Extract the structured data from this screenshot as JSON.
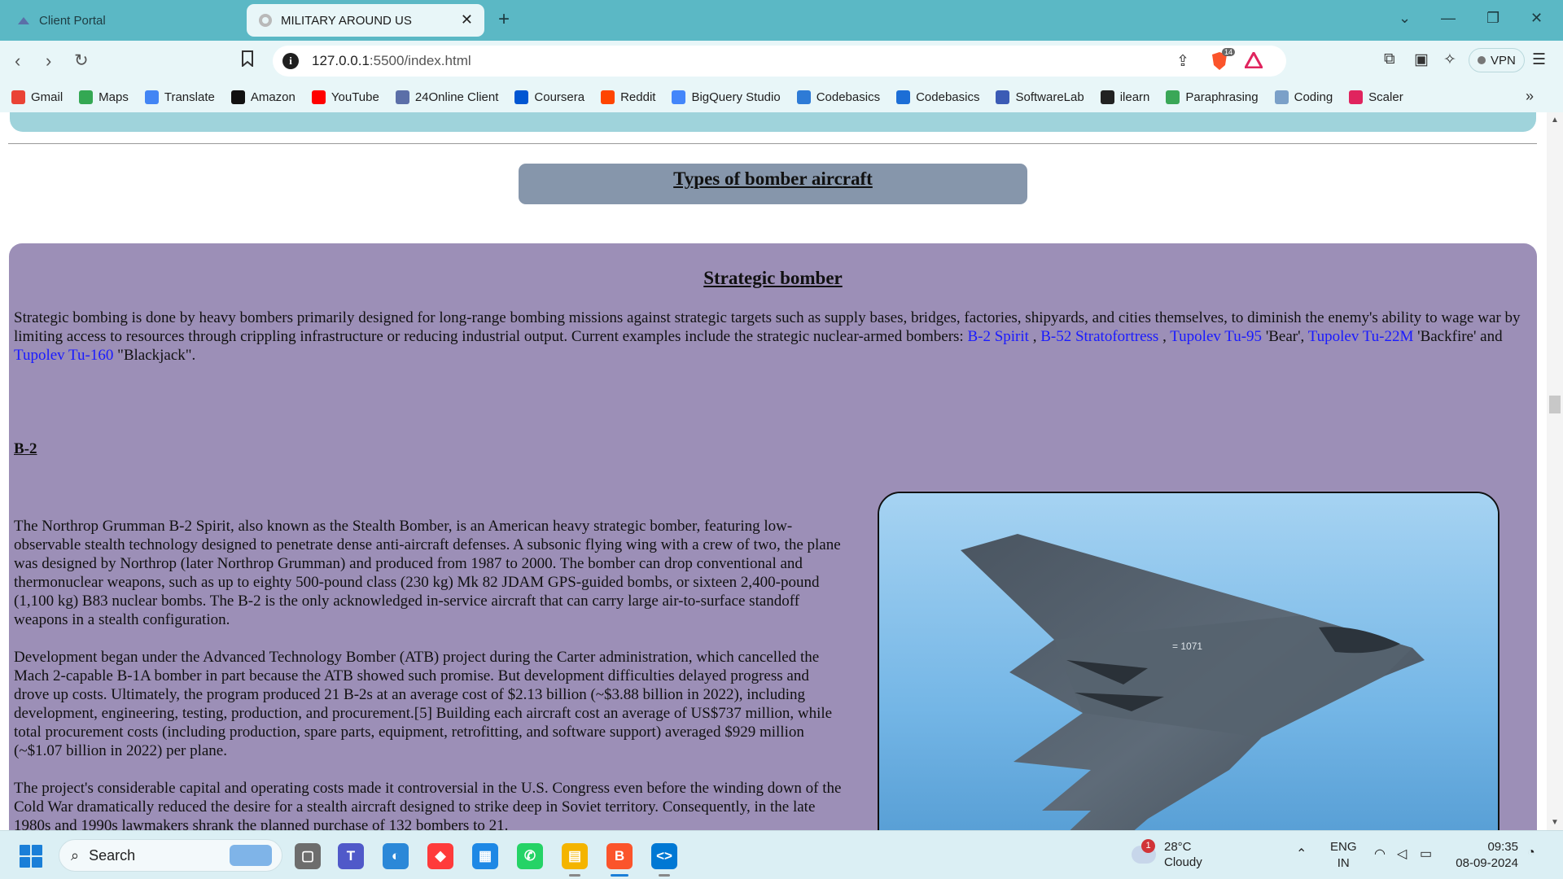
{
  "browser": {
    "tabs": [
      {
        "label": "Client Portal",
        "active": false
      },
      {
        "label": "MILITARY AROUND US",
        "active": true
      }
    ],
    "url_host": "127.0.0.1",
    "url_rest": ":5500/index.html",
    "shields_count": "14",
    "vpn_label": "VPN"
  },
  "bookmarks": [
    {
      "label": "Gmail",
      "icon": "gmail-icon",
      "color": "#ea4335"
    },
    {
      "label": "Maps",
      "icon": "maps-icon",
      "color": "#34a853"
    },
    {
      "label": "Translate",
      "icon": "translate-icon",
      "color": "#4285f4"
    },
    {
      "label": "Amazon",
      "icon": "amazon-icon",
      "color": "#111111"
    },
    {
      "label": "YouTube",
      "icon": "youtube-icon",
      "color": "#ff0000"
    },
    {
      "label": "24Online Client",
      "icon": "24online-icon",
      "color": "#5b6fa8"
    },
    {
      "label": "Coursera",
      "icon": "coursera-icon",
      "color": "#0056d2"
    },
    {
      "label": "Reddit",
      "icon": "reddit-icon",
      "color": "#ff4500"
    },
    {
      "label": "BigQuery Studio",
      "icon": "bigquery-icon",
      "color": "#4386fa"
    },
    {
      "label": "Codebasics",
      "icon": "rocket-icon",
      "color": "#2e7bd6"
    },
    {
      "label": "Codebasics",
      "icon": "codebasics-icon",
      "color": "#1c6ed6"
    },
    {
      "label": "SoftwareLab",
      "icon": "softwarelab-icon",
      "color": "#3b5bb5"
    },
    {
      "label": "ilearn",
      "icon": "ilearn-icon",
      "color": "#222222"
    },
    {
      "label": "Paraphrasing",
      "icon": "paraphrasing-icon",
      "color": "#3aa757"
    },
    {
      "label": "Coding",
      "icon": "coding-icon",
      "color": "#7aa0c8"
    },
    {
      "label": "Scaler",
      "icon": "scaler-icon",
      "color": "#e0245e"
    }
  ],
  "page": {
    "section_heading": "Types of bomber aircraft",
    "card_title": "Strategic bomber",
    "intro_text": "Strategic bombing is done by heavy bombers primarily designed for long-range bombing missions against strategic targets such as supply bases, bridges, factories, shipyards, and cities themselves, to diminish the enemy's ability to wage war by limiting access to resources through crippling infrastructure or reducing industrial output. Current examples include the strategic nuclear-armed bombers: ",
    "links": {
      "b2": "B-2 Spirit",
      "sep1": " , ",
      "b52": "B-52 Stratofortress",
      "sep2": " , ",
      "tu95": "Tupolev Tu-95",
      "after_tu95": " 'Bear', ",
      "tu22m": "Tupolev Tu-22M",
      "after_tu22m": " 'Backfire' and ",
      "tu160": "Tupolev Tu-160",
      "after_tu160": " \"Blackjack\"."
    },
    "subheading": "B-2",
    "paragraphs": [
      "The Northrop Grumman B-2 Spirit, also known as the Stealth Bomber, is an American heavy strategic bomber, featuring low-observable stealth technology designed to penetrate dense anti-aircraft defenses. A subsonic flying wing with a crew of two, the plane was designed by Northrop (later Northrop Grumman) and produced from 1987 to 2000. The bomber can drop conventional and thermonuclear weapons, such as up to eighty 500-pound class (230 kg) Mk 82 JDAM GPS-guided bombs, or sixteen 2,400-pound (1,100 kg) B83 nuclear bombs. The B-2 is the only acknowledged in-service aircraft that can carry large air-to-surface standoff weapons in a stealth configuration.",
      "Development began under the Advanced Technology Bomber (ATB) project during the Carter administration, which cancelled the Mach 2-capable B-1A bomber in part because the ATB showed such promise. But development difficulties delayed progress and drove up costs. Ultimately, the program produced 21 B-2s at an average cost of $2.13 billion (~$3.88 billion in 2022), including development, engineering, testing, production, and procurement.[5] Building each aircraft cost an average of US$737 million, while total procurement costs (including production, spare parts, equipment, retrofitting, and software support) averaged $929 million (~$1.07 billion in 2022) per plane.",
      "The project's considerable capital and operating costs made it controversial in the U.S. Congress even before the winding down of the Cold War dramatically reduced the desire for a stealth aircraft designed to strike deep in Soviet territory. Consequently, in the late 1980s and 1990s lawmakers shrank the planned purchase of 132 bombers to 21."
    ],
    "aircraft_marking": "= 1071"
  },
  "taskbar": {
    "search_label": "Search",
    "weather_temp": "28°C",
    "weather_desc": "Cloudy",
    "weather_badge": "1",
    "lang_top": "ENG",
    "lang_bottom": "IN",
    "time": "09:35",
    "date": "08-09-2024"
  }
}
